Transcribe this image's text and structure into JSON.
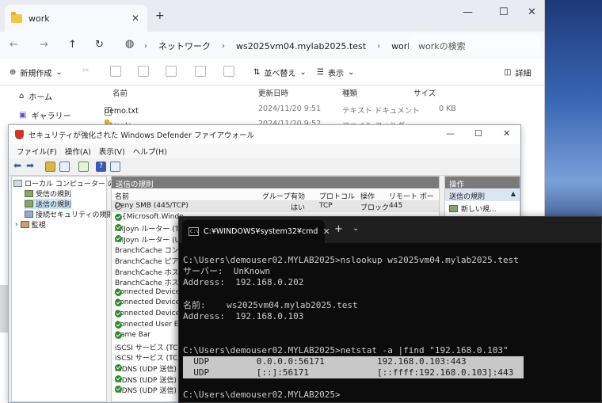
{
  "explorer": {
    "tab_title": "work",
    "tab_close": "✕",
    "new_tab": "+",
    "breadcrumbs": [
      "ネットワーク",
      "ws2025vm04.mylab2025.test",
      "work"
    ],
    "search_placeholder": "workの検索",
    "toolbar": {
      "new_label": "新規作成",
      "sort_label": "並べ替え",
      "view_label": "表示",
      "details_label": "詳細"
    },
    "sidebar": [
      {
        "label": "ホーム"
      },
      {
        "label": "ギャラリー"
      }
    ],
    "columns": [
      "名前",
      "更新日時",
      "種類",
      "サイズ"
    ],
    "files": [
      {
        "name": "demo.txt",
        "modified": "2024/11/20 9:51",
        "type": "テキスト ドキュメント",
        "size": "0 KB"
      },
      {
        "name": "sample",
        "modified": "2024/11/20 9:52",
        "type": "ファイル フォルダー",
        "size": ""
      }
    ]
  },
  "firewall": {
    "title": "セキュリティが強化された Windows Defender ファイアウォール",
    "menu": [
      "ファイル(F)",
      "操作(A)",
      "表示(V)",
      "ヘルプ(H)"
    ],
    "tree": [
      {
        "label": "ローカル コンピューター のセキュ"
      },
      {
        "label": "受信の規則"
      },
      {
        "label": "送信の規則"
      },
      {
        "label": "接続セキュリティの規則"
      },
      {
        "label": "監視"
      }
    ],
    "main_header": "送信の規則",
    "columns": [
      "名前",
      "グループ",
      "有効",
      "プロトコル",
      "操作",
      "リモート ポート"
    ],
    "rules": [
      {
        "name": "Deny SMB (445/TCP)",
        "enabled": "はい",
        "protocol": "TCP",
        "action": "ブロック",
        "port": "445",
        "icon": "block"
      },
      {
        "name": "@{Microsoft.Windo",
        "icon": "check"
      },
      {
        "name": "AllJoyn ルーター (TC",
        "icon": "check"
      },
      {
        "name": "AllJoyn ルーター (UD",
        "icon": "check"
      },
      {
        "name": "BranchCache コンテン",
        "icon": "none"
      },
      {
        "name": "BranchCache ピア検",
        "icon": "none"
      },
      {
        "name": "BranchCache ホスト",
        "icon": "none"
      },
      {
        "name": "BranchCache ホスト",
        "icon": "none"
      },
      {
        "name": "Connected Devices",
        "icon": "check"
      },
      {
        "name": "Connected Devices",
        "icon": "check"
      },
      {
        "name": "Connected Devices",
        "icon": "check"
      },
      {
        "name": "Connected User Ex",
        "icon": "check"
      },
      {
        "name": "Game Bar",
        "icon": "check"
      },
      {
        "name": "iSCSI サービス (TCP",
        "icon": "none"
      },
      {
        "name": "iSCSI サービス (TCP",
        "icon": "none"
      },
      {
        "name": "mDNS (UDP 送信)",
        "icon": "check"
      },
      {
        "name": "mDNS (UDP 送信)",
        "icon": "check"
      },
      {
        "name": "mDNS (UDP 送信)",
        "icon": "check"
      }
    ],
    "actions_header": "操作",
    "actions_sub": "送信の規則",
    "actions_new": "新しい規..."
  },
  "terminal": {
    "tab_title": "C:¥WINDOWS¥system32¥cmd",
    "lines": [
      {
        "text": "C:\\Users\\demouser02.MYLAB2025>nslookup ws2025vm04.mylab2025.test",
        "hl": false
      },
      {
        "text": "サーバー:  UnKnown",
        "hl": false
      },
      {
        "text": "Address:  192.168.0.202",
        "hl": false
      },
      {
        "text": "",
        "hl": false
      },
      {
        "text": "名前:    ws2025vm04.mylab2025.test",
        "hl": false
      },
      {
        "text": "Address:  192.168.0.103",
        "hl": false
      },
      {
        "text": "",
        "hl": false
      },
      {
        "text": "",
        "hl": false
      },
      {
        "text": "C:\\Users\\demouser02.MYLAB2025>netstat -a |find \"192.168.0.103\"",
        "hl": false
      },
      {
        "text": "  UDP         0.0.0.0:56171          192.168.0.103:443",
        "hl": true
      },
      {
        "text": "  UDP         [::]:56171             [::ffff:192.168.0.103]:443",
        "hl": true
      },
      {
        "text": "",
        "hl": false
      },
      {
        "text": "C:\\Users\\demouser02.MYLAB2025>",
        "hl": false
      }
    ]
  }
}
